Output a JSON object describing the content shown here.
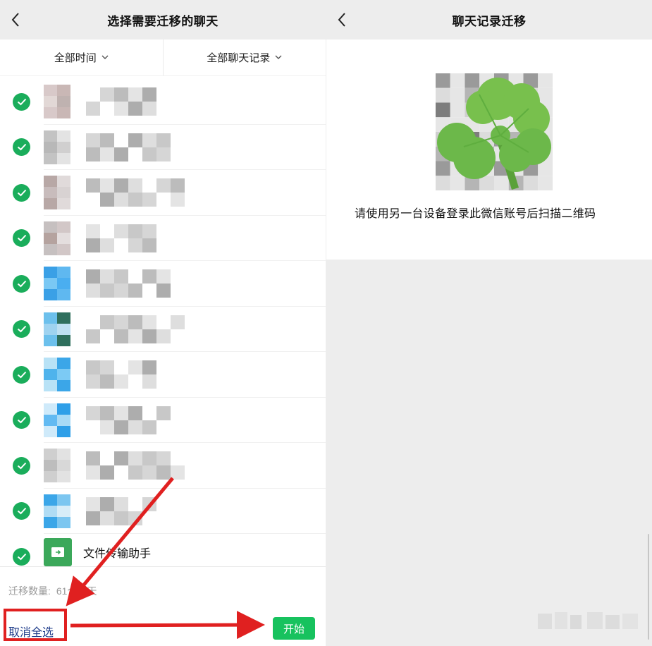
{
  "left": {
    "title": "选择需要迁移的聊天",
    "filters": [
      "全部时间",
      "全部聊天记录"
    ],
    "file_item": "文件传输助手",
    "count_label": "迁移数量:",
    "count_value": "61个聊天",
    "cancel_label": "取消全选",
    "start_label": "开始"
  },
  "right": {
    "title": "聊天记录迁移",
    "instruction": "请使用另一台设备登录此微信账号后扫描二维码"
  },
  "colors": {
    "check_green": "#1aad5b",
    "start_green": "#17c25e",
    "annotation_red": "#e02020",
    "clover_green": "#6cb84a"
  }
}
